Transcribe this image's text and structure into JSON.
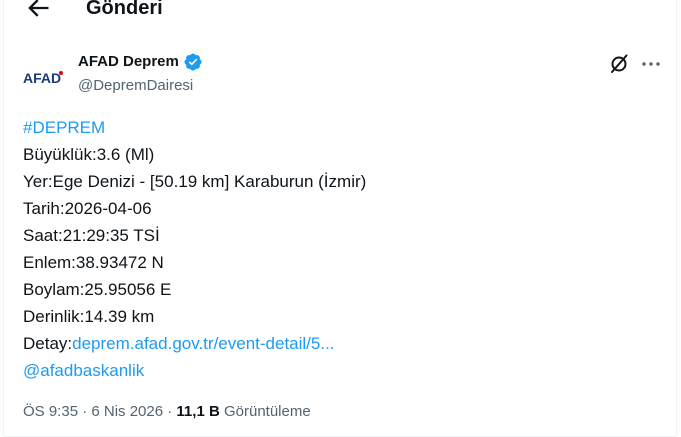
{
  "header": {
    "title": "Gönderi",
    "back_icon": "arrow-left-icon"
  },
  "author": {
    "avatar_text": "AFAD",
    "name": "AFAD Deprem",
    "handle": "@DepremDairesi",
    "verified_icon": "verified-badge-icon",
    "brand_color": "#e4001b",
    "verified_color": "#1d9bf0"
  },
  "actions": {
    "grok_icon": "grok-icon",
    "more_icon": "more-horizontal-icon"
  },
  "tweet": {
    "hashtag": "#DEPREM",
    "magnitude": "Büyüklük:3.6 (Ml)",
    "location": "Yer:Ege Denizi - [50.19 km] Karaburun (İzmir)",
    "date": "Tarih:2026-04-06",
    "time": "Saat:21:29:35 TSİ",
    "latitude": "Enlem:38.93472 N",
    "longitude": "Boylam:25.95056 E",
    "depth": "Derinlik:14.39 km",
    "detail_label": "Detay:",
    "detail_link": "deprem.afad.gov.tr/event-detail/5...",
    "mention": "@afadbaskanlik",
    "link_color": "#1d9bf0"
  },
  "meta": {
    "timestamp": "ÖS 9:35 · 6 Nis 2026",
    "separator": " · ",
    "views_count": "11,1 B",
    "views_label": "Görüntüleme"
  }
}
